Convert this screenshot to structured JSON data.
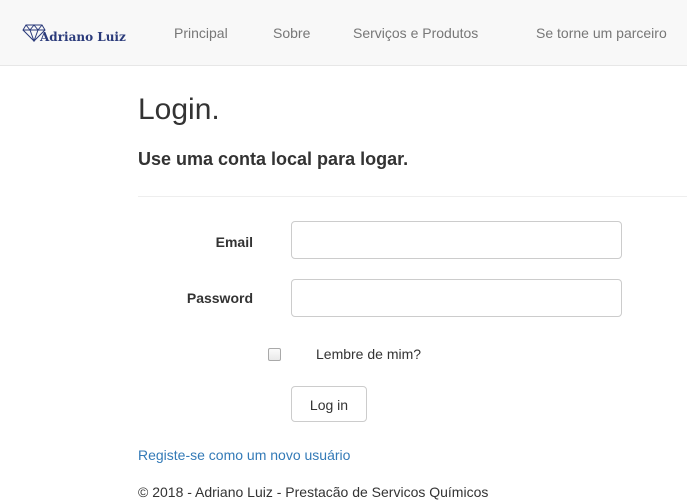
{
  "navbar": {
    "brand": "Adriano Luiz",
    "links": [
      {
        "label": "Principal"
      },
      {
        "label": "Sobre"
      },
      {
        "label": "Serviços e Produtos"
      },
      {
        "label": "Se torne um parceiro"
      }
    ]
  },
  "login": {
    "title": "Login.",
    "subtitle": "Use uma conta local para logar.",
    "email_label": "Email",
    "email_value": "",
    "password_label": "Password",
    "password_value": "",
    "remember_label": "Lembre de mim?",
    "remember_checked": false,
    "submit_label": "Log in",
    "register_link": "Registe-se como um novo usuário"
  },
  "footer": {
    "text": "© 2018 - Adriano Luiz - Prestacão de Servicos Químicos"
  },
  "colors": {
    "navbar_bg": "#f8f8f8",
    "nav_link": "#777777",
    "link": "#337ab7",
    "text": "#333333",
    "brand_text": "#2a3a7a"
  },
  "icons": {
    "brand_logo": "diamond-logo-icon"
  }
}
